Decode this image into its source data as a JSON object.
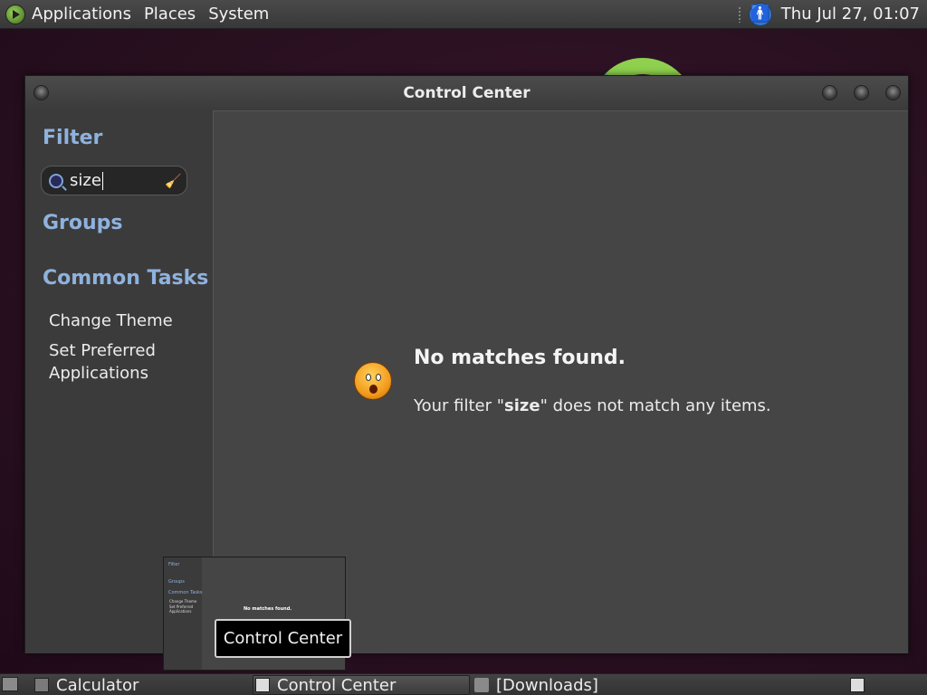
{
  "top_panel": {
    "menus": [
      "Applications",
      "Places",
      "System"
    ],
    "clock": "Thu Jul 27, 01:07",
    "icons": [
      "menu-logo-icon",
      "accessibility-icon"
    ]
  },
  "window": {
    "title": "Control Center",
    "sidebar": {
      "filter_heading": "Filter",
      "search_value": "size",
      "groups_heading": "Groups",
      "common_tasks_heading": "Common Tasks",
      "tasks": [
        "Change Theme",
        "Set Preferred Applications"
      ]
    },
    "content": {
      "no_match_title": "No matches found.",
      "no_match_prefix": "Your filter \"",
      "no_match_term": "size",
      "no_match_suffix": "\" does not match any items."
    }
  },
  "thumbnail": {
    "filter": "Filter",
    "groups": "Groups",
    "common_tasks": "Common Tasks",
    "tasks": [
      "Change Theme",
      "Set Preferred",
      "Applications"
    ],
    "no_match": "No matches found."
  },
  "tooltip": "Control Center",
  "taskbar": {
    "items": [
      "Calculator",
      "Control Center",
      "[Downloads]"
    ]
  },
  "colors": {
    "heading": "#8fb2de",
    "panel": "#3c3c3c",
    "content_bg": "#454545"
  }
}
